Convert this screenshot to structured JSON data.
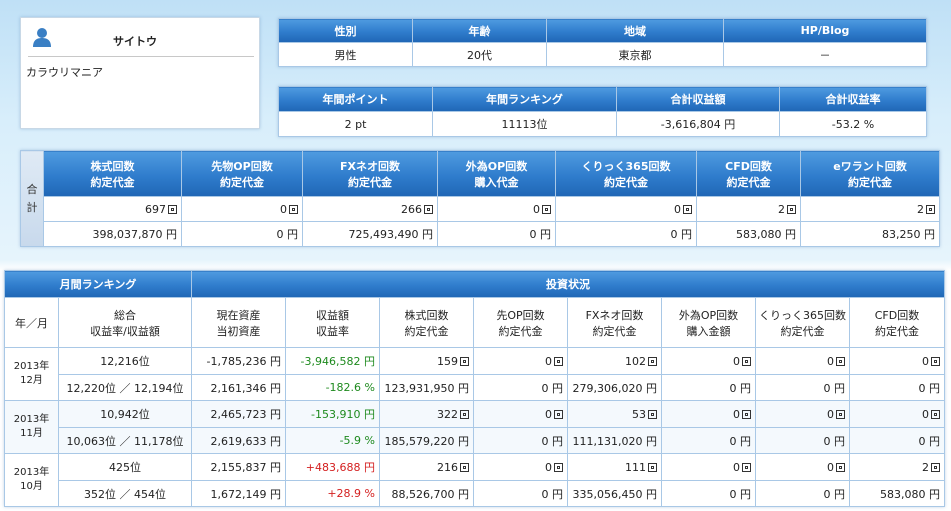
{
  "profile": {
    "name": "サイトウ",
    "title": "カラウリマニア",
    "avatar_icon": "user-icon"
  },
  "info1": {
    "headers": [
      "性別",
      "年齢",
      "地域",
      "HP/Blog"
    ],
    "values": [
      "男性",
      "20代",
      "東京都",
      "－"
    ]
  },
  "info2": {
    "headers": [
      "年間ポイント",
      "年間ランキング",
      "合計収益額",
      "合計収益率"
    ],
    "values": [
      "2 pt",
      "11113位",
      "-3,616,804 円",
      "-53.2 %"
    ]
  },
  "totals": {
    "label": "合計",
    "headers": [
      [
        "株式回数",
        "約定代金"
      ],
      [
        "先物OP回数",
        "約定代金"
      ],
      [
        "FXネオ回数",
        "約定代金"
      ],
      [
        "外為OP回数",
        "購入代金"
      ],
      [
        "くりっく365回数",
        "約定代金"
      ],
      [
        "CFD回数",
        "約定代金"
      ],
      [
        "eワラント回数",
        "約定代金"
      ]
    ],
    "counts": [
      "697",
      "0",
      "266",
      "0",
      "0",
      "2",
      "2"
    ],
    "amounts": [
      "398,037,870 円",
      "0 円",
      "725,493,490 円",
      "0 円",
      "0 円",
      "583,080 円",
      "83,250 円"
    ]
  },
  "monthly": {
    "group_ranking": "月間ランキング",
    "group_invest": "投資状況",
    "col_month": "年／月",
    "headers": [
      [
        "総合",
        "収益率/収益額"
      ],
      [
        "現在資産",
        "当初資産"
      ],
      [
        "収益額",
        "収益率"
      ],
      [
        "株式回数",
        "約定代金"
      ],
      [
        "先OP回数",
        "約定代金"
      ],
      [
        "FXネオ回数",
        "約定代金"
      ],
      [
        "外為OP回数",
        "購入金額"
      ],
      [
        "くりっく365回数",
        "約定代金"
      ],
      [
        "CFD回数",
        "約定代金"
      ]
    ],
    "rows": [
      {
        "year": "2013年",
        "month": "12月",
        "rank1": "12,216位",
        "rank2": "12,220位 ／ 12,194位",
        "asset_now": "-1,785,236 円",
        "asset_init": "2,161,346 円",
        "profit": "-3,946,582 円",
        "rate": "-182.6 %",
        "stock_c": "159",
        "stock_a": "123,931,950 円",
        "op_c": "0",
        "op_a": "0 円",
        "fx_c": "102",
        "fx_a": "279,306,020 円",
        "gop_c": "0",
        "gop_a": "0 円",
        "k365_c": "0",
        "k365_a": "0 円",
        "cfd_c": "0",
        "cfd_a": "0 円"
      },
      {
        "year": "2013年",
        "month": "11月",
        "rank1": "10,942位",
        "rank2": "10,063位 ／ 11,178位",
        "asset_now": "2,465,723 円",
        "asset_init": "2,619,633 円",
        "profit": "-153,910 円",
        "rate": "-5.9 %",
        "stock_c": "322",
        "stock_a": "185,579,220 円",
        "op_c": "0",
        "op_a": "0 円",
        "fx_c": "53",
        "fx_a": "111,131,020 円",
        "gop_c": "0",
        "gop_a": "0 円",
        "k365_c": "0",
        "k365_a": "0 円",
        "cfd_c": "0",
        "cfd_a": "0 円"
      },
      {
        "year": "2013年",
        "month": "10月",
        "rank1": "425位",
        "rank2": "352位 ／ 454位",
        "asset_now": "2,155,837 円",
        "asset_init": "1,672,149 円",
        "profit": "+483,688 円",
        "rate": "+28.9 %",
        "stock_c": "216",
        "stock_a": "88,526,700 円",
        "op_c": "0",
        "op_a": "0 円",
        "fx_c": "111",
        "fx_a": "335,056,450 円",
        "gop_c": "0",
        "gop_a": "0 円",
        "k365_c": "0",
        "k365_a": "0 円",
        "cfd_c": "2",
        "cfd_a": "583,080 円"
      }
    ]
  },
  "colors": {
    "header_blue": "#2f7ccc",
    "negative_green": "#1e8a1e",
    "positive_red": "#d42020",
    "border": "#a9c8e6"
  }
}
